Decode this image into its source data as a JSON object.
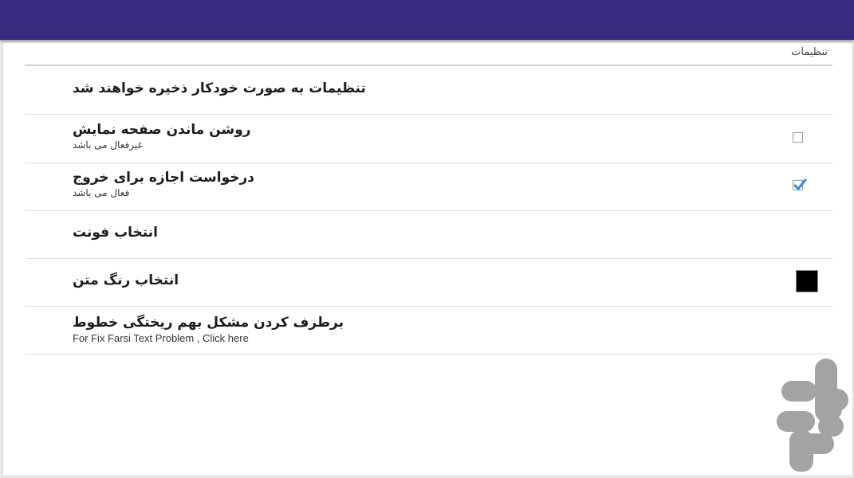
{
  "app_bar": {
    "color": "#372b7f"
  },
  "settings": {
    "header": "تنظیمات",
    "rows": [
      {
        "title": "تنظیمات به صورت خودکار ذخیره خواهند شد"
      },
      {
        "title": "روشن ماندن صفحه نمایش",
        "summary": "غیرفعال می باشد",
        "checked": false
      },
      {
        "title": "درخواست اجازه برای خروج",
        "summary": "فعال می باشد",
        "checked": true
      },
      {
        "title": "انتخاب فونت"
      },
      {
        "title": "انتخاب رنگ متن",
        "color": "#000000"
      },
      {
        "title": "برطرف کردن مشکل بهم ریختگی خطوط",
        "summary": "For Fix Farsi Text Problem , Click here"
      }
    ]
  },
  "icons": {
    "checkbox_checked": "checkbox-checked-icon",
    "checkbox_unchecked": "checkbox-unchecked-icon",
    "logo": "store-logo-icon"
  },
  "accent_color": "#2a8fd6"
}
